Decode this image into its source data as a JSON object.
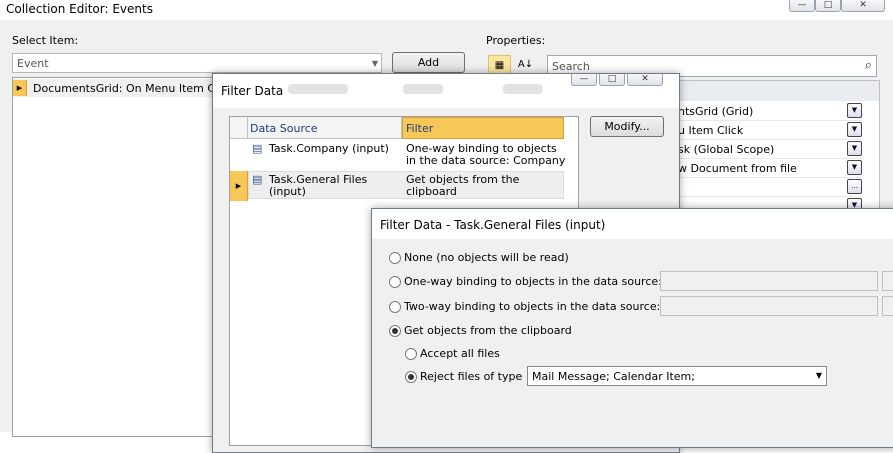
{
  "main_window": {
    "title": "Collection Editor: Events",
    "controls": {
      "minimize": "—",
      "maximize": "□",
      "close": "✕"
    },
    "select_item_label": "Select Item:",
    "event_combo_value": "Event",
    "add_label": "Add",
    "items": [
      {
        "label": "DocumentsGrid: On Menu Item Click"
      }
    ],
    "properties_label": "Properties:",
    "search_placeholder": "Search",
    "property_rows": [
      {
        "value": "ntsGrid (Grid)",
        "button": "▼"
      },
      {
        "value": "u Item Click",
        "button": "▼"
      },
      {
        "value": "sk (Global Scope)",
        "button": "▼"
      },
      {
        "value": "w Document from file",
        "button": "▼"
      },
      {
        "value": "",
        "button": "..."
      },
      {
        "value": "",
        "button": "▼"
      }
    ]
  },
  "filter_dialog": {
    "title": "Filter Data",
    "controls": {
      "minimize": "—",
      "maximize": "□",
      "close": "✕"
    },
    "columns": {
      "source": "Data Source",
      "filter": "Filter"
    },
    "modify_label": "Modify...",
    "rows": [
      {
        "source": "Task.Company (input)",
        "filter": "One-way binding to objects in the data source: Company",
        "selected": false
      },
      {
        "source": "Task.General Files (input)",
        "filter": "Get objects from the clipboard",
        "selected": true
      }
    ]
  },
  "filter_detail_dialog": {
    "title": "Filter Data - Task.General Files (input)",
    "options": {
      "none": "None (no objects will be read)",
      "one_way": "One-way binding to objects in the data source:",
      "two_way": "Two-way binding to objects in the data source:",
      "clipboard": "Get objects from the clipboard"
    },
    "selected_option": "clipboard",
    "sub_options": {
      "accept_all": "Accept all files",
      "reject": "Reject files of type"
    },
    "selected_sub_option": "reject",
    "reject_types_value": "Mail Message; Calendar Item;"
  },
  "colors": {
    "accent_header": "#f7c758",
    "selection": "#eeeeee"
  }
}
